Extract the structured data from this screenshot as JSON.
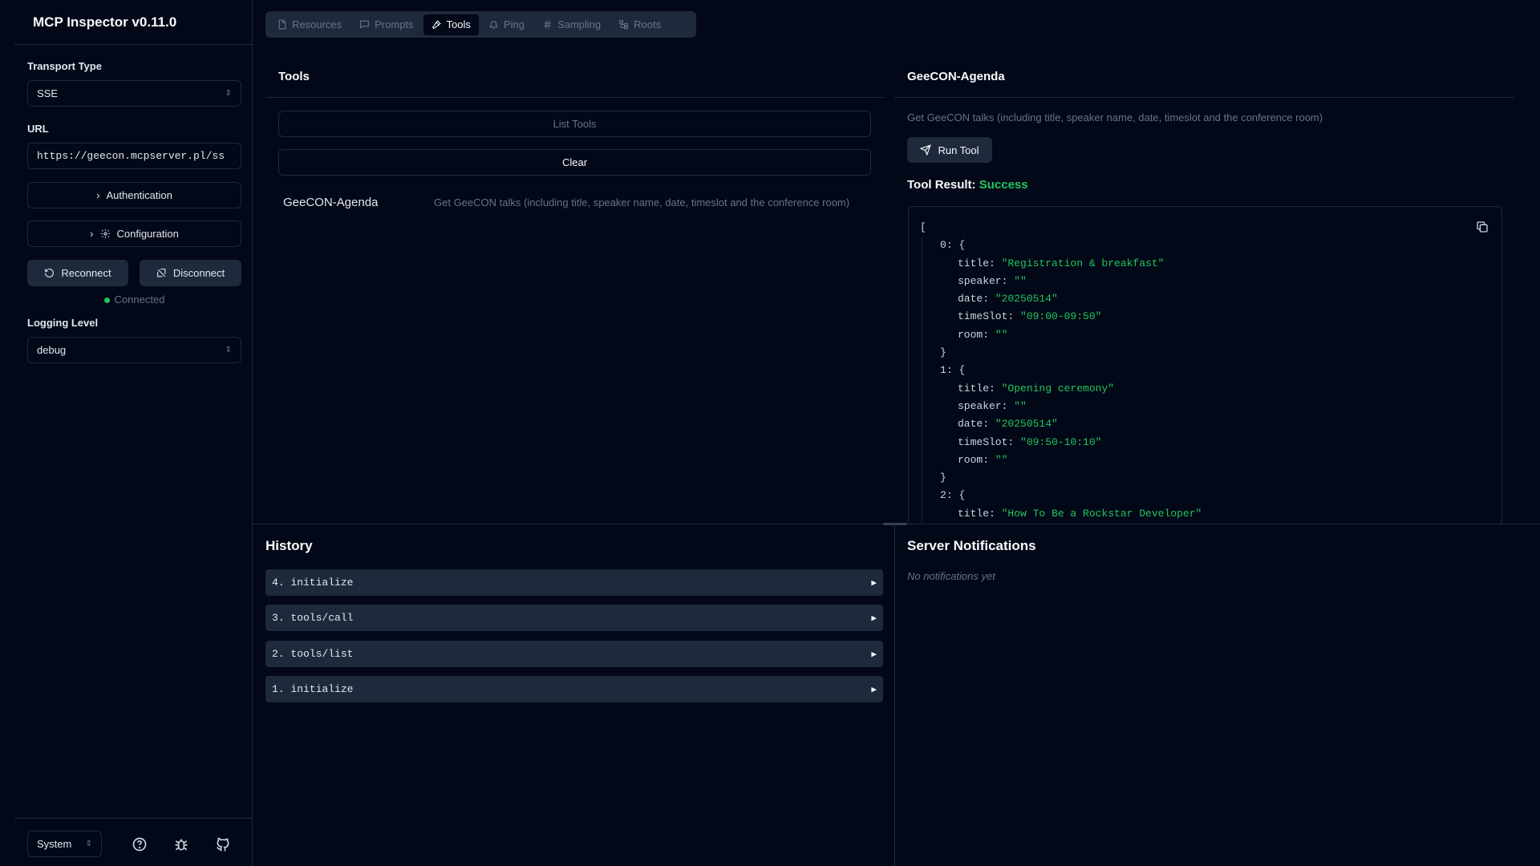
{
  "app": {
    "title": "MCP Inspector v0.11.0"
  },
  "sidebar": {
    "transport_label": "Transport Type",
    "transport_value": "SSE",
    "url_label": "URL",
    "url_value": "https://geecon.mcpserver.pl/ss",
    "authentication_label": "Authentication",
    "configuration_label": "Configuration",
    "reconnect_label": "Reconnect",
    "disconnect_label": "Disconnect",
    "status_text": "Connected",
    "logging_label": "Logging Level",
    "logging_value": "debug",
    "theme_value": "System"
  },
  "tabs": [
    {
      "label": "Resources",
      "icon": "file-icon",
      "active": false
    },
    {
      "label": "Prompts",
      "icon": "message-icon",
      "active": false
    },
    {
      "label": "Tools",
      "icon": "hammer-icon",
      "active": true
    },
    {
      "label": "Ping",
      "icon": "bell-icon",
      "active": false
    },
    {
      "label": "Sampling",
      "icon": "hash-icon",
      "active": false
    },
    {
      "label": "Roots",
      "icon": "folder-tree-icon",
      "active": false
    }
  ],
  "tools_panel": {
    "title": "Tools",
    "list_button": "List Tools",
    "clear_button": "Clear",
    "items": [
      {
        "name": "GeeCON-Agenda",
        "description": "Get GeeCON talks (including title, speaker name, date, timeslot and the conference room)"
      }
    ]
  },
  "tool_detail": {
    "title": "GeeCON-Agenda",
    "description": "Get GeeCON talks (including title, speaker name, date, timeslot and the conference room)",
    "run_button": "Run Tool",
    "result_label": "Tool Result:",
    "result_status": "Success",
    "result_items": [
      {
        "index": "0",
        "title": "\"Registration & breakfast\"",
        "speaker": "\"\"",
        "date": "\"20250514\"",
        "timeSlot": "\"09:00-09:50\"",
        "room": "\"\""
      },
      {
        "index": "1",
        "title": "\"Opening ceremony\"",
        "speaker": "\"\"",
        "date": "\"20250514\"",
        "timeSlot": "\"09:50-10:10\"",
        "room": "\"\""
      },
      {
        "index": "2",
        "title": "\"How To Be a Rockstar Developer\""
      }
    ]
  },
  "history": {
    "title": "History",
    "entries": [
      "4. initialize",
      "3. tools/call",
      "2. tools/list",
      "1. initialize"
    ]
  },
  "notifications": {
    "title": "Server Notifications",
    "empty_text": "No notifications yet"
  },
  "colors": {
    "background": "#020817",
    "panel": "#1e293b",
    "success": "#22c55e",
    "muted": "#64748b"
  }
}
